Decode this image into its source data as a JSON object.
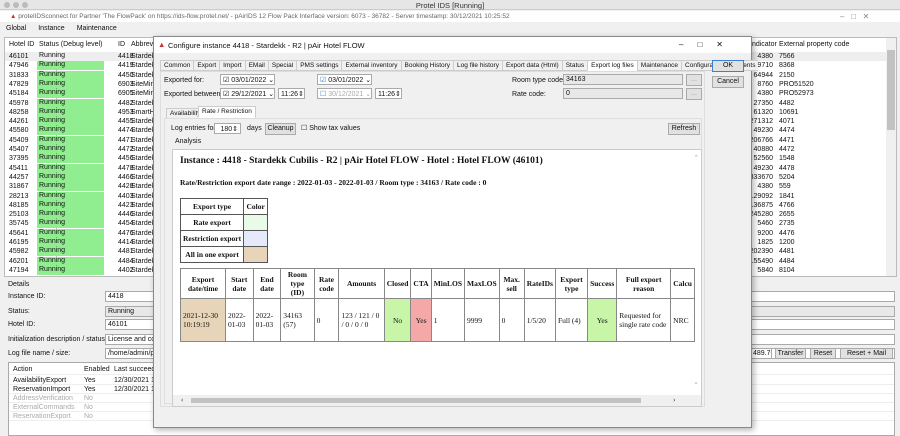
{
  "window": {
    "title": "Protel IDS [Running]",
    "subtitle": "protelIDSconnect for Partner 'The FlowPack' on     https://ids-flow.protel.net/ - pAirIDS 12 Flow Pack      Interface version: 6073 - 36782 - Server timestamp: 30/12/2021 10:25:52"
  },
  "menu": [
    "Global",
    "Instance",
    "Maintenance"
  ],
  "grid": {
    "headers": {
      "hotel_id": "Hotel ID",
      "status": "Status (Debug level)",
      "id": "ID",
      "abbrev": "Abbrevia",
      "indicator": "Indicator",
      "ext": "External property code"
    },
    "rows": [
      [
        "46101",
        "Running",
        "4418",
        "Stardekk",
        "4380",
        "7566"
      ],
      [
        "47946",
        "Running",
        "4419",
        "Stardekk",
        "19710",
        "8368"
      ],
      [
        "31833",
        "Running",
        "4450",
        "Stardekk",
        "64944",
        "2150"
      ],
      [
        "47829",
        "Running",
        "6903",
        "SiteMind",
        "8760",
        "PRO51520"
      ],
      [
        "45184",
        "Running",
        "6905",
        "SiteMind",
        "4380",
        "PRO52973"
      ],
      [
        "45978",
        "Running",
        "4482",
        "Stardekk",
        "27350",
        "4482"
      ],
      [
        "48258",
        "Running",
        "4953",
        "SmartHo",
        "61320",
        "10691"
      ],
      [
        "44261",
        "Running",
        "4455",
        "Stardekk",
        "271312",
        "4071"
      ],
      [
        "45580",
        "Running",
        "4474",
        "Stardekk",
        "49230",
        "4474"
      ],
      [
        "45409",
        "Running",
        "4471",
        "Stardekk",
        "206766",
        "4471"
      ],
      [
        "45407",
        "Running",
        "4472",
        "Stardekk",
        "40880",
        "4472"
      ],
      [
        "37395",
        "Running",
        "4456",
        "Stardekk",
        "52560",
        "1548"
      ],
      [
        "45411",
        "Running",
        "4478",
        "Stardekk",
        "49230",
        "4478"
      ],
      [
        "44257",
        "Running",
        "4466",
        "Stardekk",
        "333670",
        "5204"
      ],
      [
        "31867",
        "Running",
        "4428",
        "Stardekk",
        "4380",
        "559"
      ],
      [
        "28213",
        "Running",
        "4403",
        "Stardekk",
        "129092",
        "1841"
      ],
      [
        "48185",
        "Running",
        "4423",
        "Stardekk",
        "136875",
        "4766"
      ],
      [
        "25103",
        "Running",
        "4446",
        "Stardekk",
        "245280",
        "2655"
      ],
      [
        "35745",
        "Running",
        "4454",
        "Stardekk",
        "5460",
        "2735"
      ],
      [
        "45641",
        "Running",
        "4476",
        "Stardekk",
        "9200",
        "4476"
      ],
      [
        "46195",
        "Running",
        "4414",
        "Stardekk",
        "1825",
        "1200"
      ],
      [
        "45982",
        "Running",
        "4481",
        "Stardekk",
        "202390",
        "4481"
      ],
      [
        "46201",
        "Running",
        "4484",
        "Stardekk",
        "155490",
        "4484"
      ],
      [
        "47194",
        "Running",
        "4402",
        "Stardekk",
        "5840",
        "8104"
      ]
    ]
  },
  "details": {
    "title": "Details",
    "labels": [
      "Instance ID:",
      "Status:",
      "Hotel ID:",
      "Initialization description / status:",
      "Log file name / size:"
    ],
    "values": [
      "4418",
      "Running",
      "46101",
      "License and confi",
      "/home/admin/pro"
    ],
    "log_size": "489.767",
    "transfer": "Transfer",
    "reset": "Reset",
    "reset_mail": "Reset + Mail",
    "actions_headers": [
      "Action",
      "Enabled",
      "Last succeede"
    ],
    "actions": [
      [
        "AvailabilityExport",
        "Yes",
        "12/30/2021 10"
      ],
      [
        "ReservationImport",
        "Yes",
        "12/30/2021 10"
      ],
      [
        "AddressVerification",
        "No",
        ""
      ],
      [
        "ExternalCommands",
        "No",
        ""
      ],
      [
        "ReservationExport",
        "No",
        ""
      ]
    ]
  },
  "dialog": {
    "title": "Configure instance 4418 - Stardekk - R2 | pAir Hotel FLOW",
    "tabs": [
      "Common",
      "Export",
      "Import",
      "EMail",
      "Special",
      "PMS settings",
      "External inventory",
      "Booking History",
      "Log file history",
      "Export data (Html)",
      "Status",
      "Export log files",
      "Maintenance",
      "Configuration comments"
    ],
    "active_tab": "Export log files",
    "ok": "OK",
    "cancel": "Cancel",
    "exported_for_label": "Exported for:",
    "exported_for_from": "03/01/2022",
    "exported_for_to": "03/01/2022",
    "exported_between_label": "Exported between:",
    "between_from": "29/12/2021",
    "between_from_time": "11:26",
    "between_to": "30/12/2021",
    "between_to_time": "11:26",
    "room_type_label": "Room type code:",
    "room_type": "34163",
    "rate_code_label": "Rate code:",
    "rate_code": "0",
    "browse": "...",
    "subtabs": [
      "Availability",
      "Rate / Restriction"
    ],
    "log_entries_label": "Log entries for",
    "log_entries": "180",
    "days": "days",
    "cleanup": "Cleanup",
    "show_tax": "Show tax values",
    "refresh": "Refresh",
    "analysis": "Analysis",
    "report": {
      "heading": "Instance : 4418 - Stardekk Cubilis - R2 | pAir Hotel FLOW - Hotel : Hotel FLOW (46101)",
      "subheading": "Rate/Restriction export date range : 2022-01-03 - 2022-01-03 / Room type : 34163 / Rate code : 0",
      "legend_headers": [
        "Export type",
        "Color"
      ],
      "legend": [
        {
          "label": "Rate export",
          "color": "#e8fbe8"
        },
        {
          "label": "Restriction export",
          "color": "#e6e8fb"
        },
        {
          "label": "All in one export",
          "color": "#e8d4b8"
        }
      ],
      "headers": [
        "Export date/time",
        "Start date",
        "End date",
        "Room type (ID)",
        "Rate code",
        "Amounts",
        "Closed",
        "CTA",
        "MinLOS",
        "MaxLOS",
        "Max. sell",
        "RateIDs",
        "Export type",
        "Success",
        "Full export reason",
        "Calcu"
      ],
      "row": [
        "2021-12-30 10:19:19",
        "2022-01-03",
        "2022-01-03",
        "34163 (57)",
        "0",
        "123 / 121 / 0 / 0 / 0 / 0",
        "No",
        "Yes",
        "1",
        "9999",
        "0",
        "1/5/20",
        "Full (4)",
        "Yes",
        "Requested for single rate code",
        "NRC"
      ]
    }
  },
  "colors": {
    "running": "#90ee90",
    "no": "#c8f5a8",
    "yes_red": "#f5a8a8",
    "yes_green": "#c8f5a8",
    "all_in_one": "#e8d4b8"
  }
}
